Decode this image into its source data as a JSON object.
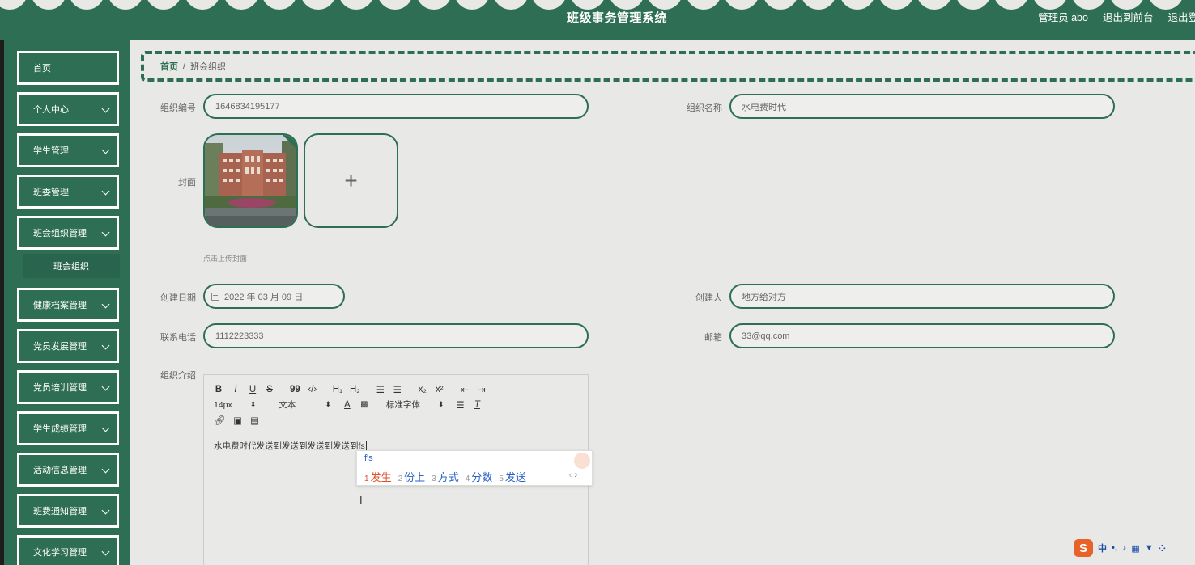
{
  "header": {
    "title": "班级事务管理系统",
    "admin": "管理员 abo",
    "to_front": "退出到前台",
    "logout": "退出登"
  },
  "sidebar": {
    "items": [
      {
        "label": "首页",
        "has_arrow": false
      },
      {
        "label": "个人中心",
        "has_arrow": true
      },
      {
        "label": "学生管理",
        "has_arrow": true
      },
      {
        "label": "班委管理",
        "has_arrow": true
      },
      {
        "label": "班会组织管理",
        "has_arrow": true,
        "expanded": true
      },
      {
        "label": "健康档案管理",
        "has_arrow": true
      },
      {
        "label": "党员发展管理",
        "has_arrow": true
      },
      {
        "label": "党员培训管理",
        "has_arrow": true
      },
      {
        "label": "学生成绩管理",
        "has_arrow": true
      },
      {
        "label": "活动信息管理",
        "has_arrow": true
      },
      {
        "label": "班费通知管理",
        "has_arrow": true
      },
      {
        "label": "文化学习管理",
        "has_arrow": true
      }
    ],
    "sub_item": "班会组织"
  },
  "breadcrumb": {
    "home": "首页",
    "separator": "/",
    "current": "班会组织"
  },
  "form": {
    "org_id_label": "组织编号",
    "org_id_value": "1646834195177",
    "org_name_label": "组织名称",
    "org_name_value": "水电费时代",
    "cover_label": "封面",
    "upload_hint": "点击上传封面",
    "add_symbol": "+",
    "date_label": "创建日期",
    "date_value": "2022 年 03 月 09 日",
    "creator_label": "创建人",
    "creator_value": "地方给对方",
    "phone_label": "联系电话",
    "phone_value": "1112223333",
    "email_label": "邮箱",
    "email_value": "33@qq.com",
    "intro_label": "组织介绍"
  },
  "editor": {
    "row1": [
      "B",
      "I",
      "U",
      "S",
      "99",
      "‹/›",
      "H₁",
      "H₂",
      "☰",
      "☰",
      "x₂",
      "x²",
      "⇤",
      "⇥"
    ],
    "font_size": "14px",
    "text_style": "文本",
    "font_family": "标准字体",
    "content": "水电费时代发送到发送到发送到发送到fs"
  },
  "ime": {
    "composition": "f's",
    "candidates": [
      {
        "n": "1",
        "text": "发生"
      },
      {
        "n": "2",
        "text": "份上"
      },
      {
        "n": "3",
        "text": "方式"
      },
      {
        "n": "4",
        "text": "分数"
      },
      {
        "n": "5",
        "text": "发送"
      }
    ]
  },
  "tray": {
    "lang": "中"
  },
  "colors": {
    "primary": "#2e6e55",
    "background": "#e8e9e6",
    "ime_highlight": "#e04e2a",
    "ime_text": "#2a62c9"
  }
}
